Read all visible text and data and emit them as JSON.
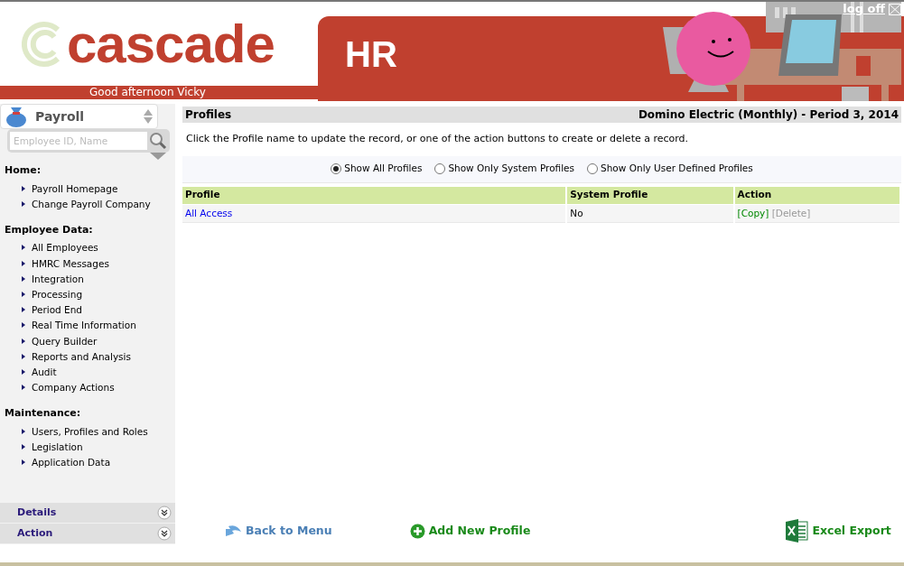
{
  "header": {
    "logo": "cascade",
    "product": "HR",
    "log_off": "log off",
    "greeting": "Good afternoon Vicky"
  },
  "sidebar": {
    "module": "Payroll",
    "search": {
      "placeholder": "Employee ID, Name"
    },
    "sections": [
      {
        "heading": "Home:",
        "items": [
          "Payroll Homepage",
          "Change Payroll Company"
        ]
      },
      {
        "heading": "Employee Data:",
        "items": [
          "All Employees",
          "HMRC Messages",
          "Integration",
          "Processing",
          "Period End",
          "Real Time Information",
          "Query Builder",
          "Reports and Analysis",
          "Audit",
          "Company Actions"
        ]
      },
      {
        "heading": "Maintenance:",
        "items": [
          "Users, Profiles and Roles",
          "Legislation",
          "Application Data"
        ]
      }
    ],
    "panels": [
      {
        "label": "Details"
      },
      {
        "label": "Action"
      }
    ]
  },
  "main": {
    "title": "Profiles",
    "company": "Domino Electric (Monthly) - Period 3, 2014",
    "instructions": "Click the Profile name to update the record, or one of the action buttons to create or delete a record.",
    "filters": [
      {
        "label": "Show All Profiles",
        "selected": true
      },
      {
        "label": "Show Only System Profiles",
        "selected": false
      },
      {
        "label": "Show Only User Defined Profiles",
        "selected": false
      }
    ],
    "table": {
      "columns": [
        "Profile",
        "System Profile",
        "Action"
      ],
      "rows": [
        {
          "profile": "All Access",
          "system_profile": "No",
          "actions": [
            {
              "label": "[Copy]",
              "disabled": false
            },
            {
              "label": "[Delete]",
              "disabled": true
            }
          ]
        }
      ]
    },
    "footer_actions": [
      {
        "kind": "back",
        "label": "Back to Menu"
      },
      {
        "kind": "add",
        "label": "Add New Profile"
      },
      {
        "kind": "excel",
        "label": "Excel Export"
      }
    ]
  }
}
